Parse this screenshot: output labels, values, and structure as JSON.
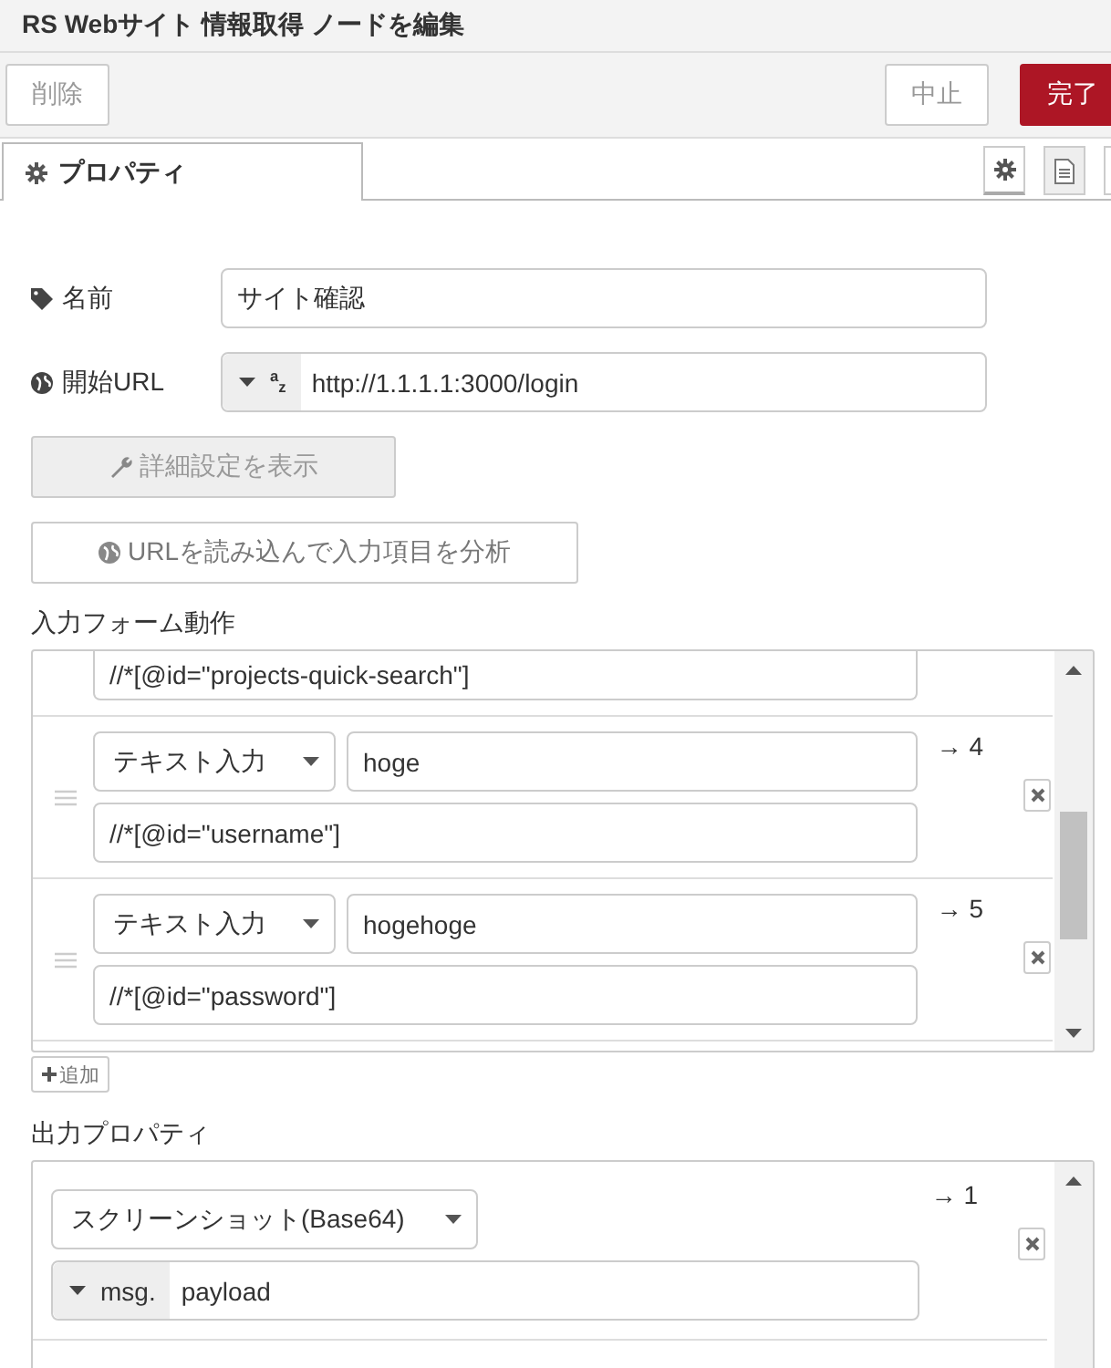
{
  "title": "RS Webサイト 情報取得 ノードを編集",
  "buttons": {
    "delete": "削除",
    "cancel": "中止",
    "done": "完了"
  },
  "tabs": [
    {
      "label": "プロパティ",
      "selected": true
    }
  ],
  "fields": [
    {
      "kind": "text",
      "label": "名前",
      "value": "サイト確認"
    },
    {
      "kind": "typed",
      "label": "開始URL",
      "type_label": "$^{a}$$_{z}$",
      "value": "http://1.1.1.1:3000/login"
    }
  ],
  "advanced_button": "詳細設定を表示",
  "analyze_button": "URLを読み込んで入力項目を分析",
  "form_actions": {
    "label": "入力フォーム動作",
    "rows": [
      {
        "xpath": "//*[@id=\"projects-quick-search\"]"
      },
      {
        "action": "テキスト入力",
        "value": "hoge",
        "xpath": "//*[@id=\"username\"]",
        "output": "→ 4"
      },
      {
        "action": "テキスト入力",
        "value": "hogehoge",
        "xpath": "//*[@id=\"password\"]",
        "output": "→ 5"
      }
    ]
  },
  "add_button": "追加",
  "output": {
    "label": "出力プロパティ",
    "rows": [
      {
        "type": "スクリーンショット(Base64)",
        "prefix": "msg.",
        "property": "payload",
        "output": "→ 1"
      }
    ]
  }
}
